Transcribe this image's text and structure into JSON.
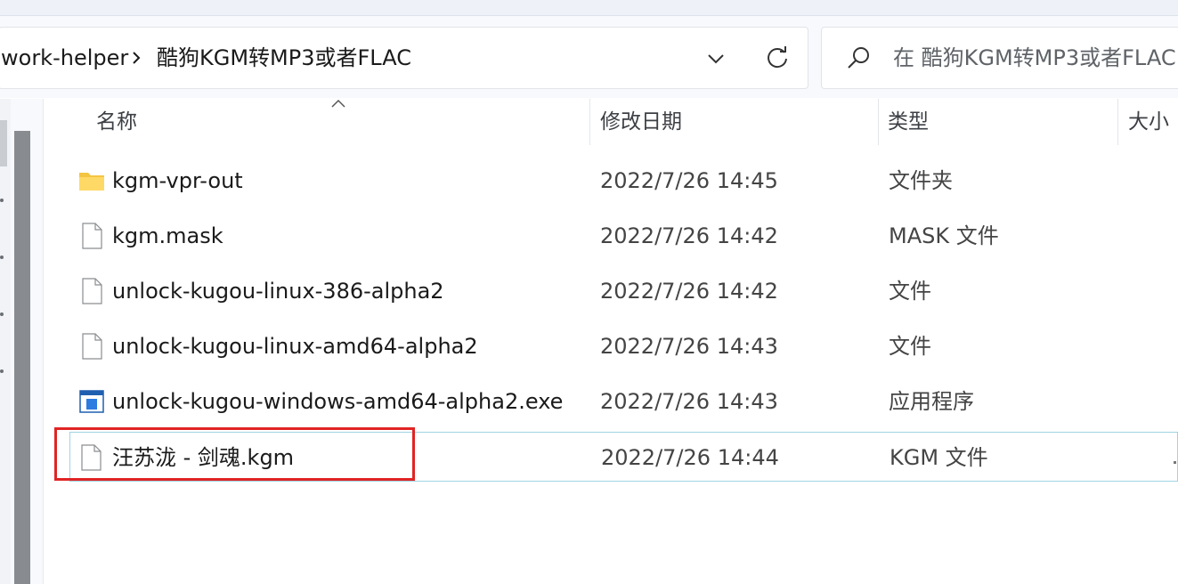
{
  "address": {
    "crumbs": [
      "work-helper",
      "酷狗KGM转MP3或者FLAC"
    ]
  },
  "search": {
    "placeholder": "在 酷狗KGM转MP3或者FLAC"
  },
  "columns": {
    "name": "名称",
    "modified": "修改日期",
    "type": "类型",
    "size": "大小"
  },
  "files": [
    {
      "name": "kgm-vpr-out",
      "modified": "2022/7/26 14:45",
      "type": "文件夹",
      "icon": "folder-icon"
    },
    {
      "name": "kgm.mask",
      "modified": "2022/7/26 14:42",
      "type": "MASK 文件",
      "icon": "file-icon"
    },
    {
      "name": "unlock-kugou-linux-386-alpha2",
      "modified": "2022/7/26 14:42",
      "type": "文件",
      "icon": "file-icon"
    },
    {
      "name": "unlock-kugou-linux-amd64-alpha2",
      "modified": "2022/7/26 14:43",
      "type": "文件",
      "icon": "file-icon"
    },
    {
      "name": "unlock-kugou-windows-amd64-alpha2.exe",
      "modified": "2022/7/26 14:43",
      "type": "应用程序",
      "icon": "exe-icon"
    },
    {
      "name": "汪苏泷 - 剑魂.kgm",
      "modified": "2022/7/26 14:44",
      "type": "KGM 文件",
      "icon": "file-icon",
      "selected": true
    }
  ],
  "colors": {
    "selection_border": "#9fd4e2",
    "annotation_red": "#e02424",
    "folder_yellow": "#f4c542"
  }
}
